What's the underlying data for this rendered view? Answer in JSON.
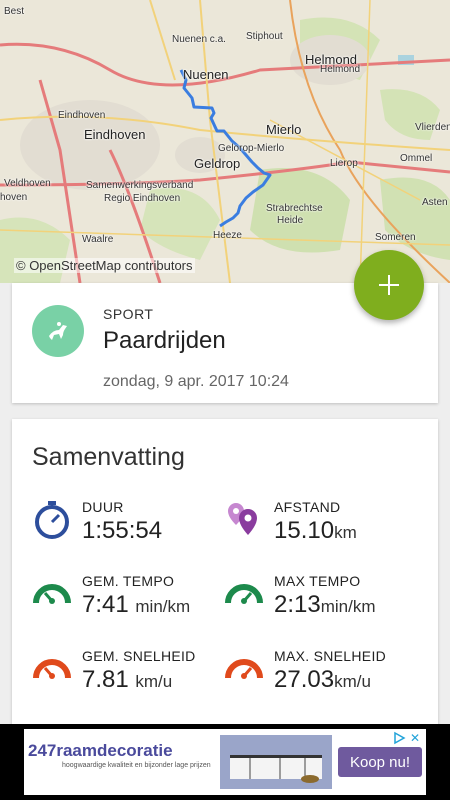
{
  "map": {
    "attribution": "© OpenStreetMap contributors",
    "places": [
      "Best",
      "Nuenen c.a.",
      "Nuenen",
      "Stiphout",
      "Helmond",
      "Helmond",
      "Eindhoven",
      "Eindhoven",
      "Mierlo",
      "Gelorop-Mierlo",
      "Geldrop",
      "Lierop",
      "Vlierden",
      "Ommel",
      "Veldhoven",
      "Samenwerkingsverband",
      "Regio Eindhoven",
      "Strabrechtse",
      "Heide",
      "Waalre",
      "Heeze",
      "Asten",
      "Someren",
      "hoven"
    ],
    "route_color": "#3a7de0"
  },
  "fab": {
    "icon": "plus-icon",
    "color": "#7fae1e"
  },
  "activity": {
    "label": "SPORT",
    "name": "Paardrijden",
    "date": "zondag, 9 apr. 2017 10:24",
    "icon": "horse-riding-icon",
    "icon_color": "#79d1a6"
  },
  "summary": {
    "title": "Samenvatting",
    "stats": [
      {
        "label": "DUUR",
        "value": "1:55:54",
        "unit": "",
        "icon": "stopwatch-icon",
        "color": "#2d4e9c"
      },
      {
        "label": "AFSTAND",
        "value": "15.10",
        "unit": "km",
        "icon": "location-pins-icon",
        "color": "#8a3c9e"
      },
      {
        "label": "GEM. TEMPO",
        "value": "7:41",
        "unit": "min/km",
        "icon": "speedometer-icon",
        "color": "#1d8a4c"
      },
      {
        "label": "MAX TEMPO",
        "value": "2:13",
        "unit": "min/km",
        "icon": "speedometer-icon",
        "color": "#1d8a4c"
      },
      {
        "label": "GEM. SNELHEID",
        "value": "7.81",
        "unit": "km/u",
        "icon": "speedometer-icon",
        "color": "#e04a1c"
      },
      {
        "label": "MAX. SNELHEID",
        "value": "27.03",
        "unit": "km/u",
        "icon": "speedometer-icon",
        "color": "#e04a1c"
      }
    ]
  },
  "ad": {
    "brand": "247raamdecoratie",
    "tagline": "hoogwaardige kwaliteit en bijzonder lage prijzen",
    "button": "Koop nu!"
  }
}
